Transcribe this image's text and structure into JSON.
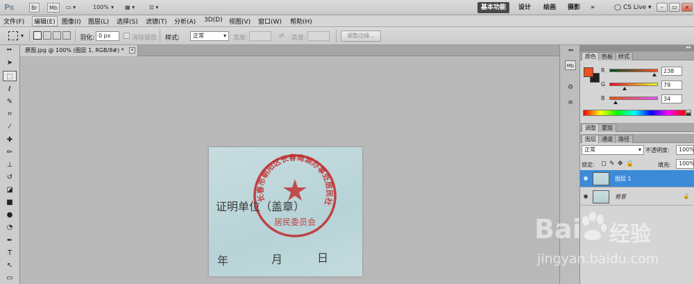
{
  "appbar": {
    "logo": "Ps",
    "br_label": "Br",
    "mb_label": "Mb",
    "zoom": "100%",
    "workspaces": [
      "基本功能",
      "设计",
      "绘画",
      "摄影"
    ],
    "more": "»",
    "cslive": "CS Live"
  },
  "menus": [
    "文件(F)",
    "编辑(E)",
    "图像(I)",
    "图层(L)",
    "选择(S)",
    "滤镜(T)",
    "分析(A)",
    "3D(D)",
    "视图(V)",
    "窗口(W)",
    "帮助(H)"
  ],
  "options": {
    "feather_label": "羽化:",
    "feather_value": "0 px",
    "antialias_label": "消除锯齿",
    "style_label": "样式:",
    "style_value": "正常",
    "width_label": "宽度:",
    "height_label": "高度:",
    "refine_button": "调整边缘..."
  },
  "document": {
    "tab_title": "原图.jpg @ 100% (图层 1, RGB/8#) *",
    "line1": "证明单位（盖章）",
    "line2_year": "年",
    "line2_month": "月",
    "line2_day": "日",
    "stamp_top": "长春市朝阳区长春南湖办事处居民社区",
    "stamp_bottom": "居民委员会"
  },
  "color_panel": {
    "tabs": [
      "颜色",
      "色板",
      "样式"
    ],
    "channels": [
      {
        "label": "R",
        "value": "238",
        "fraction": 0.933
      },
      {
        "label": "G",
        "value": "79",
        "fraction": 0.31
      },
      {
        "label": "B",
        "value": "34",
        "fraction": 0.133
      }
    ],
    "foreground": "#ee4f22",
    "background": "#222222"
  },
  "adjust_panel": {
    "tabs": [
      "调整",
      "蒙版"
    ]
  },
  "layers_panel": {
    "tabs": [
      "图层",
      "通道",
      "路径"
    ],
    "blend_mode": "正常",
    "opacity_label": "不透明度:",
    "opacity_value": "100%",
    "lock_label": "锁定:",
    "fill_label": "填充:",
    "fill_value": "100%",
    "layers": [
      {
        "name": "图层 1",
        "active": true
      },
      {
        "name": "背景",
        "active": false
      }
    ]
  },
  "watermark": {
    "brand_left": "Bai",
    "brand_right": "经验",
    "url": "jingyan.baidu.com"
  },
  "colors": {
    "selection_blue": "#3c8ad8",
    "stamp_red": "#c0282a"
  }
}
